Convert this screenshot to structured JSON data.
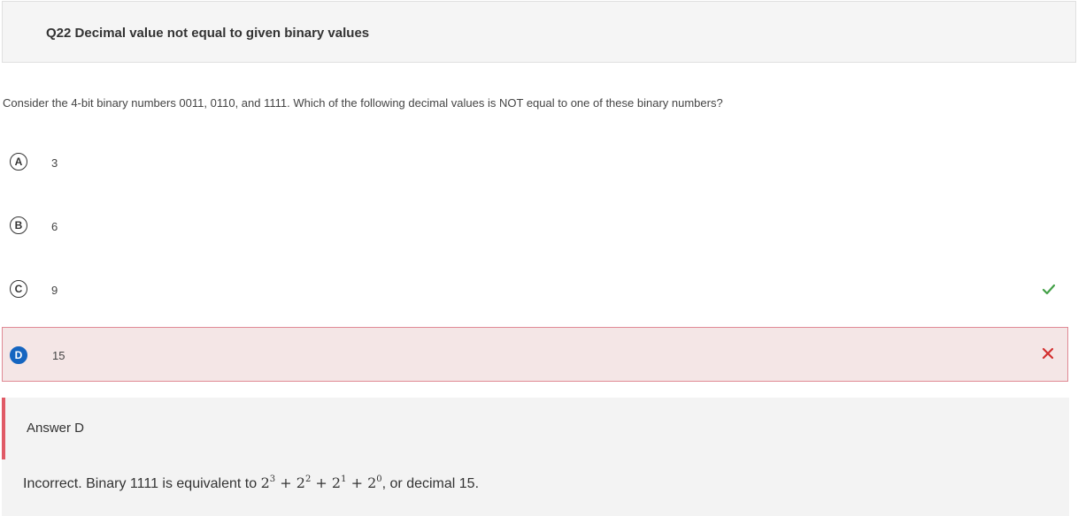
{
  "header": {
    "title": "Q22 Decimal value not equal to given binary values"
  },
  "question": {
    "text": "Consider the 4-bit binary numbers 0011, 0110, and 1111. Which of the following decimal values is NOT equal to one of these binary numbers?"
  },
  "options": [
    {
      "letter": "A",
      "value": "3",
      "state": "none"
    },
    {
      "letter": "B",
      "value": "6",
      "state": "none"
    },
    {
      "letter": "C",
      "value": "9",
      "state": "correct",
      "icon": "check-icon"
    },
    {
      "letter": "D",
      "value": "15",
      "state": "selected-incorrect",
      "icon": "close-icon"
    }
  ],
  "explanation": {
    "answer_label": "Answer D",
    "text_before": "Incorrect. Binary 1111 is equivalent to",
    "math": {
      "base": "2",
      "exponents": [
        "3",
        "2",
        "1",
        "0"
      ],
      "operator": "+"
    },
    "text_after": ", or decimal 15."
  },
  "colors": {
    "correct": "#43a047",
    "incorrect": "#d32f2f",
    "selected_badge": "#1565c0",
    "selected_background": "#f4e6e6",
    "explanation_bar": "#e05a66"
  }
}
